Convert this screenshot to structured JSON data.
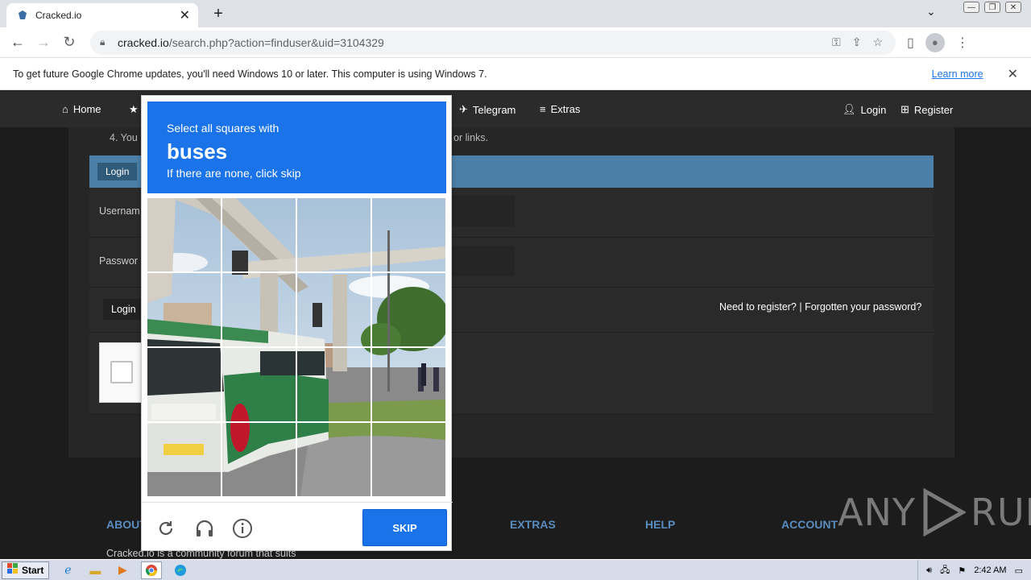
{
  "browser": {
    "tab_title": "Cracked.io",
    "tab_close": "✕",
    "new_tab": "+",
    "url_host": "cracked.io",
    "url_path": "/search.php?action=finduser&uid=3104329"
  },
  "infobar": {
    "message": "To get future Google Chrome updates, you'll need Windows 10 or later. This computer is using Windows 7.",
    "link": "Learn more",
    "close": "✕"
  },
  "site": {
    "nav": {
      "home": "Home",
      "telegram": "Telegram",
      "extras": "Extras",
      "login": "Login",
      "register": "Register"
    },
    "rules_fragment_left": "4. You",
    "rules_fragment_right": "or links.",
    "login_header": "Login",
    "username_label": "Usernam",
    "password_label": "Passwor",
    "login_button": "Login",
    "register_links": "Need to register? | Forgotten your password?",
    "footer": {
      "about": "ABOUT",
      "extras": "EXTRAS",
      "help": "HELP",
      "account": "ACCOUNT",
      "text": "Cracked.io is a community forum that suits"
    }
  },
  "captcha": {
    "instruction": "Select all squares with",
    "target": "buses",
    "hint": "If there are none, click skip",
    "skip_label": "SKIP"
  },
  "watermark": {
    "left": "ANY",
    "right": "RUN"
  },
  "taskbar": {
    "start": "Start",
    "clock": "2:42 AM"
  },
  "colors": {
    "captcha_blue": "#1a73e8",
    "login_bar": "#4a7fa8",
    "footer_heading": "#5a8dbf"
  }
}
